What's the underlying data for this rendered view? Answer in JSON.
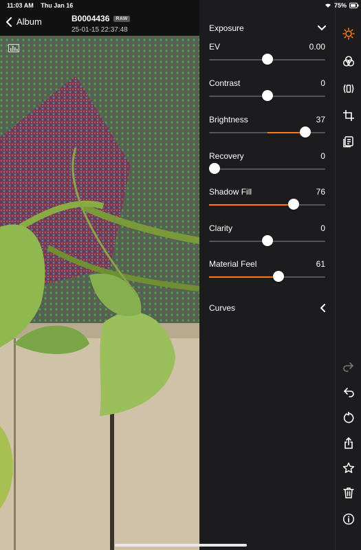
{
  "status": {
    "time": "11:03 AM",
    "date": "Thu Jan 16",
    "battery": "75%"
  },
  "nav": {
    "back_label": "Album",
    "file_name": "B0004436",
    "raw_badge": "RAW",
    "datetime": "25-01-15 22:37:48"
  },
  "panel": {
    "section_title": "Exposure",
    "sliders": [
      {
        "label": "EV",
        "value": "0.00",
        "pos": 0.5,
        "fill_from": 0.5
      },
      {
        "label": "Contrast",
        "value": "0",
        "pos": 0.5,
        "fill_from": 0.5
      },
      {
        "label": "Brightness",
        "value": "37",
        "pos": 0.83,
        "fill_from": 0.5
      },
      {
        "label": "Recovery",
        "value": "0",
        "pos": 0.05,
        "fill_from": 0.05
      },
      {
        "label": "Shadow Fill",
        "value": "76",
        "pos": 0.73,
        "fill_from": 0.0
      },
      {
        "label": "Clarity",
        "value": "0",
        "pos": 0.5,
        "fill_from": 0.5
      },
      {
        "label": "Material Feel",
        "value": "61",
        "pos": 0.6,
        "fill_from": 0.0
      }
    ],
    "curves_label": "Curves"
  },
  "tools": [
    "exposure-icon",
    "color-icon",
    "detail-icon",
    "crop-icon",
    "presets-icon",
    "redo-icon",
    "undo-icon",
    "reset-icon",
    "share-icon",
    "favorite-icon",
    "delete-icon",
    "info-icon"
  ],
  "colors": {
    "accent": "#ff7a1a",
    "panel_bg": "#1c1c1e"
  }
}
